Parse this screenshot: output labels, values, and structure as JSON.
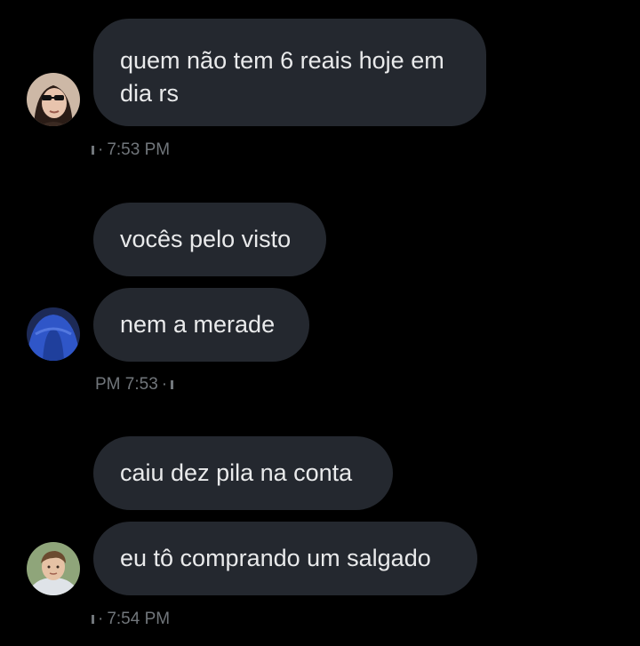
{
  "messages": [
    {
      "text": "quem não tem 6 reais hoje em dia rs",
      "time": "7:53 PM"
    },
    {
      "text_1": "vocês pelo visto",
      "text_2": "nem a merade",
      "time": "PM 7:53"
    },
    {
      "text_1": "caiu dez pila na conta",
      "text_2": "eu tô comprando um salgado",
      "time": "7:54 PM"
    }
  ],
  "meta_separator": "·",
  "avatars": {
    "user_1": "avatar-woman-sunglasses",
    "user_2": "avatar-blue-hoodie",
    "user_3": "avatar-young-man"
  },
  "colors": {
    "background": "#000000",
    "bubble": "#24282f",
    "text": "#e9eaeb",
    "meta": "#71767b"
  }
}
